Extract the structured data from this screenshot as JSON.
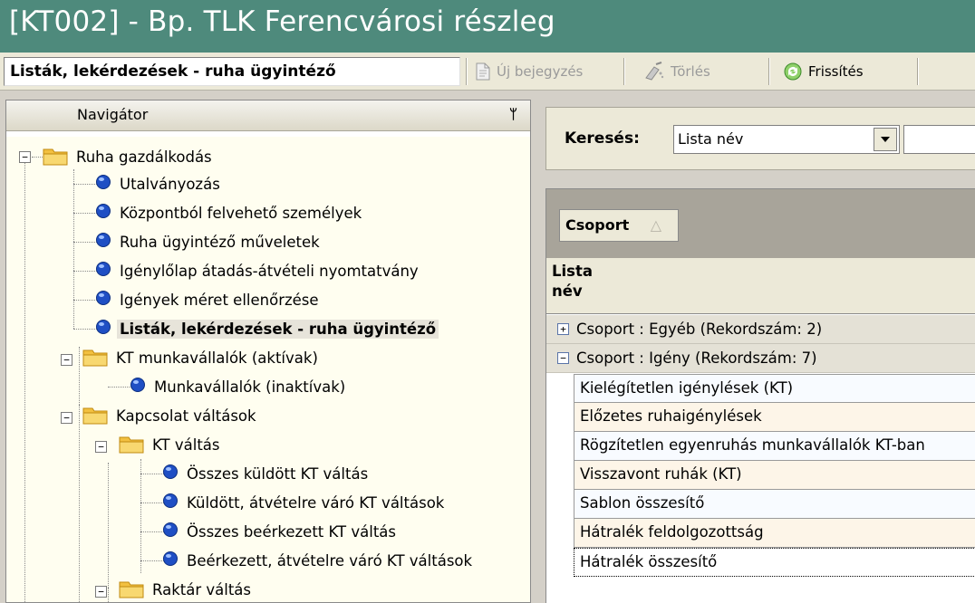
{
  "window": {
    "title": "[KT002] - Bp. TLK Ferencvárosi részleg"
  },
  "toolbar": {
    "page_label": "Listák, lekérdezések - ruha ügyintéző",
    "new_entry": "Új bejegyzés",
    "delete": "Törlés",
    "refresh": "Frissítés"
  },
  "navigator": {
    "title": "Navigátor",
    "pin": "ᵖ",
    "tree": [
      {
        "label": "Ruha gazdálkodás",
        "type": "folder"
      },
      {
        "label": "Utalványozás",
        "type": "item"
      },
      {
        "label": "Központból felvehető személyek",
        "type": "item"
      },
      {
        "label": "Ruha ügyintéző műveletek",
        "type": "item"
      },
      {
        "label": "Igénylőlap átadás-átvételi nyomtatvány",
        "type": "item"
      },
      {
        "label": "Igények méret ellenőrzése",
        "type": "item"
      },
      {
        "label": "Listák, lekérdezések - ruha ügyintéző",
        "type": "item",
        "selected": true
      },
      {
        "label": "KT munkavállalók (aktívak)",
        "type": "folder"
      },
      {
        "label": "Munkavállalók (inaktívak)",
        "type": "item"
      },
      {
        "label": "Kapcsolat váltások",
        "type": "folder"
      },
      {
        "label": "KT váltás",
        "type": "folder"
      },
      {
        "label": "Összes küldött KT váltás",
        "type": "item"
      },
      {
        "label": "Küldött, átvételre váró KT váltások",
        "type": "item"
      },
      {
        "label": "Összes beérkezett KT váltás",
        "type": "item"
      },
      {
        "label": "Beérkezett, átvételre váró KT váltások",
        "type": "item"
      },
      {
        "label": "Raktár váltás",
        "type": "folder"
      }
    ]
  },
  "search": {
    "label": "Keresés:",
    "field": "Lista név",
    "value": ""
  },
  "grid": {
    "group_chip": "Csoport",
    "sort_indicator": "△",
    "column_header": "Lista név",
    "groups": [
      {
        "label": "Csoport : Egyéb (Rekordszám: 2)",
        "expanded": false,
        "toggle": "+"
      },
      {
        "label": "Csoport : Igény (Rekordszám: 7)",
        "expanded": true,
        "toggle": "−"
      }
    ],
    "rows": [
      "Kielégítetlen igénylések (KT)",
      "Előzetes ruhaigénylések",
      "Rögzítetlen egyenruhás munkavállalók KT-ban",
      "Visszavont ruhák (KT)",
      "Sablon összesítő",
      "Hátralék feldolgozottság",
      "Hátralék összesítő"
    ]
  },
  "colors": {
    "title_bar": "#4e8a7c",
    "tree_background": "#fffef0",
    "node_bullet": "#1f4fc4",
    "folder": "#f2c040"
  }
}
